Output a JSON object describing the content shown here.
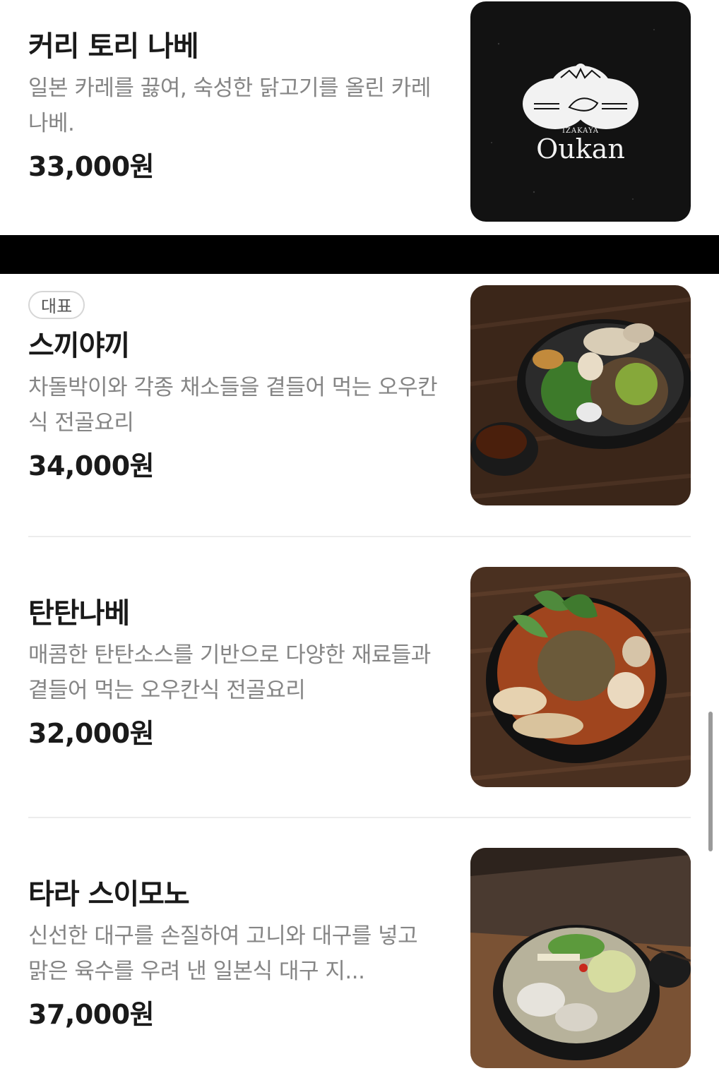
{
  "menu": {
    "items": [
      {
        "name": "커리 토리 나베",
        "description": "일본 카레를 끓여, 숙성한 닭고기를 올린 카레 나베.",
        "price": "33,000원",
        "badge": null,
        "image": "oukan-logo"
      },
      {
        "name": "스끼야끼",
        "description": "차돌박이와 각종 채소들을 곁들어 먹는 오우칸식 전골요리",
        "price": "34,000원",
        "badge": "대표",
        "image": "sukiyaki-photo"
      },
      {
        "name": "탄탄나베",
        "description": "매콤한 탄탄소스를 기반으로 다양한 재료들과 곁들어 먹는 오우칸식 전골요리",
        "price": "32,000원",
        "badge": null,
        "image": "tantan-nabe-photo"
      },
      {
        "name": "타라 스이모노",
        "description": "신선한 대구를 손질하여 고니와 대구를 넣고 맑은 육수를 우려 낸 일본식 대구 지...",
        "price": "37,000원",
        "badge": null,
        "image": "tara-suimono-photo"
      }
    ]
  },
  "logo": {
    "small_text": "IZAKAYA",
    "brand_text": "Oukan"
  },
  "colors": {
    "background": "#ffffff",
    "title": "#1a1a1a",
    "description": "#858585",
    "divider": "#ececec",
    "banner": "#000000"
  }
}
